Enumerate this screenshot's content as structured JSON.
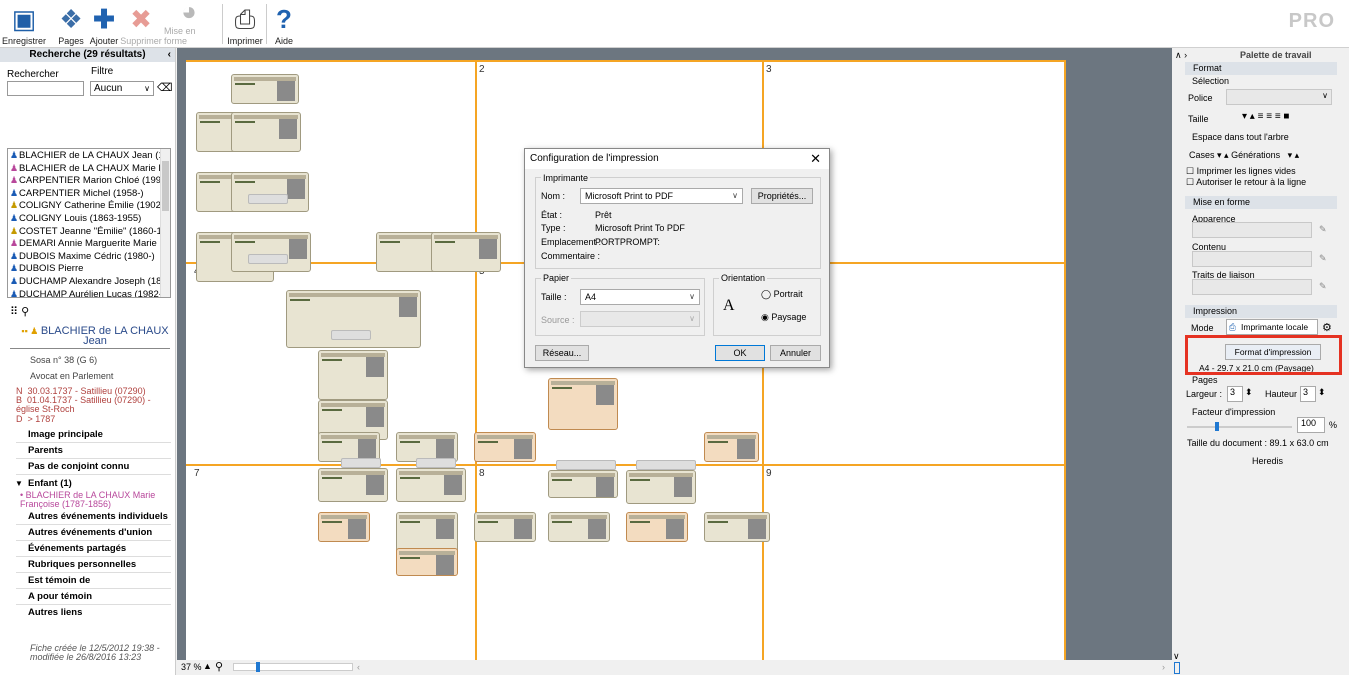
{
  "toolbar": {
    "items": [
      {
        "label": "Enregistrer",
        "icon": "floppy-icon"
      },
      {
        "label": "Pages",
        "icon": "pages-icon"
      },
      {
        "label": "Ajouter",
        "icon": "add-icon"
      },
      {
        "label": "Supprimer",
        "icon": "delete-icon"
      },
      {
        "label": "Mise en forme",
        "icon": "palette-icon"
      },
      {
        "label": "Imprimer",
        "icon": "printer-icon"
      },
      {
        "label": "Aide",
        "icon": "help-icon"
      }
    ],
    "pro": "PRO"
  },
  "left": {
    "header": "Recherche (29 résultats)",
    "search_label": "Rechercher",
    "filter_label": "Filtre",
    "filter_value": "Aucun",
    "people": [
      {
        "name": "BLACHIER de LA CHAUX Jean (173...",
        "sex": "m"
      },
      {
        "name": "BLACHIER de LA CHAUX Marie Fra...",
        "sex": "f"
      },
      {
        "name": "CARPENTIER Marion Chloé (1992-)",
        "sex": "f"
      },
      {
        "name": "CARPENTIER Michel (1958-)",
        "sex": "m"
      },
      {
        "name": "COLIGNY Catherine Émilie (1902-19...",
        "sex": "u"
      },
      {
        "name": "COLIGNY Louis (1863-1955)",
        "sex": "m"
      },
      {
        "name": "COSTET Jeanne \"Émilie\" (1860-1949)",
        "sex": "u"
      },
      {
        "name": "DEMARI Annie Marguerite Marie (19...",
        "sex": "f"
      },
      {
        "name": "DUBOIS Maxime Cédric (1980-)",
        "sex": "m"
      },
      {
        "name": "DUBOIS Pierre",
        "sex": "m"
      },
      {
        "name": "DUCHAMP Alexandre Joseph (1849...",
        "sex": "m"
      },
      {
        "name": "DUCHAMP Aurélien Lucas (1982-)",
        "sex": "m"
      }
    ],
    "fiche": {
      "name": "BLACHIER de LA CHAUX",
      "firstname": "Jean",
      "sosa": "Sosa n° 38 (G 6)",
      "job": "Avocat en Parlement",
      "events": [
        {
          "k": "N",
          "t": "30.03.1737 - Satillieu (07290)"
        },
        {
          "k": "B",
          "t": "01.04.1737 - Satillieu (07290) - église St-Roch"
        },
        {
          "k": "D",
          "t": "> 1787"
        }
      ],
      "sections": [
        "Image principale",
        "Parents",
        "Pas de conjoint connu"
      ],
      "child_header": "Enfant (1)",
      "child": "BLACHIER de LA CHAUX Marie Françoise (1787-1856)",
      "sections2": [
        "Autres événements individuels",
        "Autres événements d'union",
        "Événements partagés",
        "Rubriques personnelles",
        "Est témoin de",
        "A pour témoin",
        "Autres liens"
      ],
      "created": "Fiche créée le 12/5/2012 19:38 -",
      "modified": "modifiée le 26/8/2016 13:23"
    }
  },
  "canvas": {
    "pages": [
      "2",
      "3",
      "4",
      "5",
      "6",
      "7",
      "8",
      "9"
    ],
    "zoom": "37 %"
  },
  "dialog": {
    "title": "Configuration de l'impression",
    "printer_group": "Imprimante",
    "name_label": "Nom :",
    "name_value": "Microsoft Print to PDF",
    "properties": "Propriétés...",
    "status_label": "État :",
    "status_value": "Prêt",
    "type_label": "Type :",
    "type_value": "Microsoft Print To PDF",
    "location_label": "Emplacement :",
    "location_value": "PORTPROMPT:",
    "comment_label": "Commentaire :",
    "paper_group": "Papier",
    "size_label": "Taille :",
    "size_value": "A4",
    "source_label": "Source :",
    "orientation_group": "Orientation",
    "portrait": "Portrait",
    "landscape": "Paysage",
    "network": "Réseau...",
    "ok": "OK",
    "cancel": "Annuler"
  },
  "right": {
    "title": "Palette de travail",
    "format": "Format",
    "selection": "Sélection",
    "police": "Police",
    "taille": "Taille",
    "space": "Espace dans tout l'arbre",
    "cases": "Cases",
    "generations": "Générations",
    "print_empty": "Imprimer les lignes vides",
    "autoreturn": "Autoriser le retour à la ligne",
    "layout": "Mise en forme",
    "appearance": "Apparence",
    "content": "Contenu",
    "links": "Traits de liaison",
    "print": "Impression",
    "mode": "Mode",
    "mode_value": "Imprimante locale",
    "print_format": "Format d'impression",
    "paper_info": "A4 - 29.7 x 21.0 cm (Paysage)",
    "pages": "Pages",
    "width_label": "Largeur :",
    "width_value": "3",
    "height_label": "Hauteur :",
    "height_value": "3",
    "factor": "Facteur d'impression",
    "factor_value": "100",
    "pct": "%",
    "doc_size": "Taille du document :   89.1 x 63.0 cm",
    "heredis": "Heredis"
  }
}
